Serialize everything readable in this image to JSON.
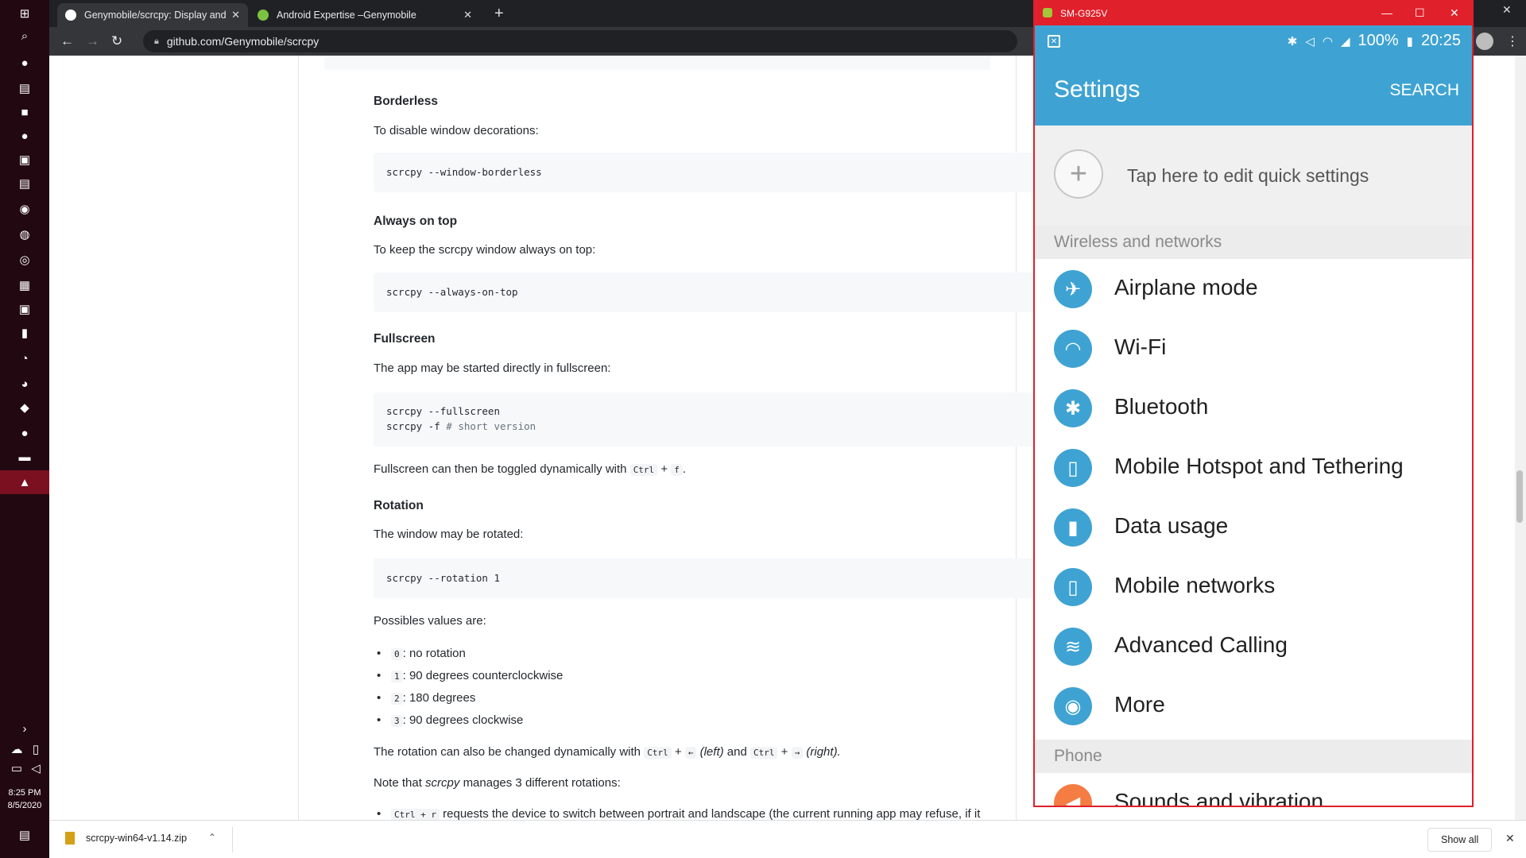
{
  "taskbar": {
    "time": "8:25 PM",
    "date": "8/5/2020"
  },
  "browser": {
    "tabs": [
      {
        "label": "Genymobile/scrcpy: Display and"
      },
      {
        "label": "Android Expertise –Genymobile"
      }
    ],
    "url": "github.com/Genymobile/scrcpy"
  },
  "article": {
    "borderless": {
      "heading": "Borderless",
      "text": "To disable window decorations:",
      "code": "scrcpy --window-borderless"
    },
    "always_on_top": {
      "heading": "Always on top",
      "text": "To keep the scrcpy window always on top:",
      "code": "scrcpy --always-on-top"
    },
    "fullscreen": {
      "heading": "Fullscreen",
      "text": "The app may be started directly in fullscreen:",
      "code1": "scrcpy --fullscreen",
      "code2_cmd": "scrcpy -f ",
      "code2_comment": "# short version",
      "toggle_pre": "Fullscreen can then be toggled dynamically with",
      "key_ctrl": "Ctrl",
      "key_f": "f"
    },
    "rotation": {
      "heading": "Rotation",
      "text": "The window may be rotated:",
      "code": "scrcpy --rotation 1",
      "values_intro": "Possibles values are:",
      "values": [
        {
          "key": "0",
          "desc": ": no rotation"
        },
        {
          "key": "1",
          "desc": ": 90 degrees counterclockwise"
        },
        {
          "key": "2",
          "desc": ": 180 degrees"
        },
        {
          "key": "3",
          "desc": ": 90 degrees clockwise"
        }
      ],
      "dyn_pre": "The rotation can also be changed dynamically with",
      "key_ctrl": "Ctrl",
      "key_left": "←",
      "left_label": "(left)",
      "and": "and",
      "key_right": "→",
      "right_label": "(right).",
      "note_pre": "Note that",
      "note_em": "scrcpy",
      "note_post": "manages 3 different rotations:",
      "cut_key": "Ctrl + r",
      "cut_text": "requests the device to switch between portrait and landscape (the current running app may refuse, if it"
    }
  },
  "downloads": {
    "file": "scrcpy-win64-v1.14.zip",
    "show_all": "Show all"
  },
  "phone": {
    "window_title": "SM-G925V",
    "battery": "100%",
    "clock": "20:25",
    "title": "Settings",
    "search": "SEARCH",
    "quick_settings": "Tap here to edit quick settings",
    "section_wireless": "Wireless and networks",
    "items": [
      {
        "label": "Airplane mode",
        "icon": "airplane-icon"
      },
      {
        "label": "Wi-Fi",
        "icon": "wifi-icon"
      },
      {
        "label": "Bluetooth",
        "icon": "bluetooth-icon"
      },
      {
        "label": "Mobile Hotspot and Tethering",
        "icon": "hotspot-icon"
      },
      {
        "label": "Data usage",
        "icon": "data-usage-icon"
      },
      {
        "label": "Mobile networks",
        "icon": "mobile-networks-icon"
      },
      {
        "label": "Advanced Calling",
        "icon": "advanced-calling-icon"
      },
      {
        "label": "More",
        "icon": "more-icon"
      }
    ],
    "section_phone": "Phone",
    "sounds": "Sounds and vibration",
    "colors": {
      "accent": "#3ea3d3",
      "window_border": "#e0202a",
      "sound_icon": "#f57c42"
    }
  }
}
